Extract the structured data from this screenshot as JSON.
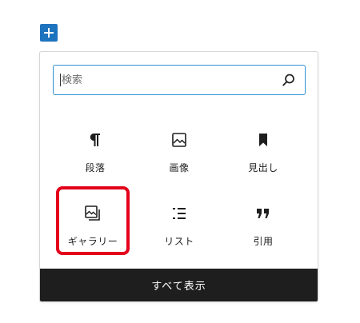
{
  "toolbar": {
    "add_block_icon": "plus-icon",
    "accent_color": "#1e73be"
  },
  "inserter": {
    "search": {
      "placeholder": "検索",
      "value": "",
      "icon": "search-icon"
    },
    "blocks": [
      {
        "id": "paragraph",
        "label": "段落",
        "icon": "pilcrow-icon"
      },
      {
        "id": "image",
        "label": "画像",
        "icon": "image-icon"
      },
      {
        "id": "heading",
        "label": "見出し",
        "icon": "bookmark-icon"
      },
      {
        "id": "gallery",
        "label": "ギャラリー",
        "icon": "gallery-icon",
        "highlighted": true,
        "highlight_color": "#e3001b"
      },
      {
        "id": "list",
        "label": "リスト",
        "icon": "list-icon"
      },
      {
        "id": "quote",
        "label": "引用",
        "icon": "quote-icon"
      }
    ],
    "show_all_label": "すべて表示"
  }
}
